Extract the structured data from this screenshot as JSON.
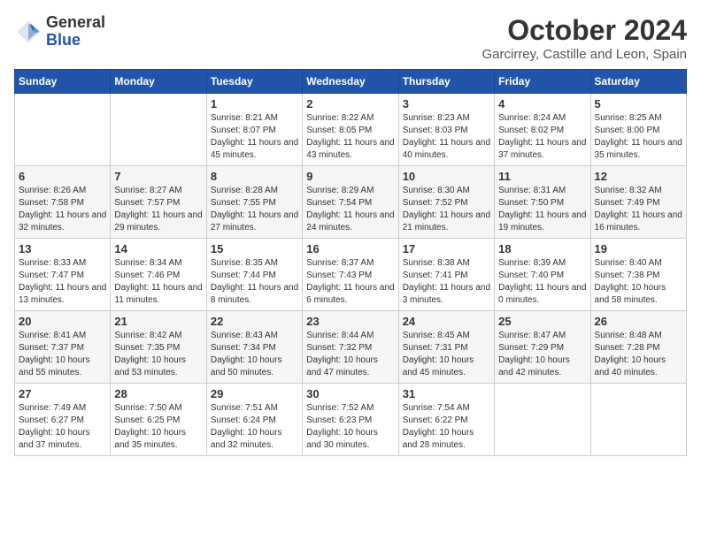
{
  "header": {
    "logo_line1": "General",
    "logo_line2": "Blue",
    "main_title": "October 2024",
    "subtitle": "Garcirrey, Castille and Leon, Spain"
  },
  "calendar": {
    "days_of_week": [
      "Sunday",
      "Monday",
      "Tuesday",
      "Wednesday",
      "Thursday",
      "Friday",
      "Saturday"
    ],
    "weeks": [
      [
        {
          "day": "",
          "info": ""
        },
        {
          "day": "",
          "info": ""
        },
        {
          "day": "1",
          "info": "Sunrise: 8:21 AM\nSunset: 8:07 PM\nDaylight: 11 hours and 45 minutes."
        },
        {
          "day": "2",
          "info": "Sunrise: 8:22 AM\nSunset: 8:05 PM\nDaylight: 11 hours and 43 minutes."
        },
        {
          "day": "3",
          "info": "Sunrise: 8:23 AM\nSunset: 8:03 PM\nDaylight: 11 hours and 40 minutes."
        },
        {
          "day": "4",
          "info": "Sunrise: 8:24 AM\nSunset: 8:02 PM\nDaylight: 11 hours and 37 minutes."
        },
        {
          "day": "5",
          "info": "Sunrise: 8:25 AM\nSunset: 8:00 PM\nDaylight: 11 hours and 35 minutes."
        }
      ],
      [
        {
          "day": "6",
          "info": "Sunrise: 8:26 AM\nSunset: 7:58 PM\nDaylight: 11 hours and 32 minutes."
        },
        {
          "day": "7",
          "info": "Sunrise: 8:27 AM\nSunset: 7:57 PM\nDaylight: 11 hours and 29 minutes."
        },
        {
          "day": "8",
          "info": "Sunrise: 8:28 AM\nSunset: 7:55 PM\nDaylight: 11 hours and 27 minutes."
        },
        {
          "day": "9",
          "info": "Sunrise: 8:29 AM\nSunset: 7:54 PM\nDaylight: 11 hours and 24 minutes."
        },
        {
          "day": "10",
          "info": "Sunrise: 8:30 AM\nSunset: 7:52 PM\nDaylight: 11 hours and 21 minutes."
        },
        {
          "day": "11",
          "info": "Sunrise: 8:31 AM\nSunset: 7:50 PM\nDaylight: 11 hours and 19 minutes."
        },
        {
          "day": "12",
          "info": "Sunrise: 8:32 AM\nSunset: 7:49 PM\nDaylight: 11 hours and 16 minutes."
        }
      ],
      [
        {
          "day": "13",
          "info": "Sunrise: 8:33 AM\nSunset: 7:47 PM\nDaylight: 11 hours and 13 minutes."
        },
        {
          "day": "14",
          "info": "Sunrise: 8:34 AM\nSunset: 7:46 PM\nDaylight: 11 hours and 11 minutes."
        },
        {
          "day": "15",
          "info": "Sunrise: 8:35 AM\nSunset: 7:44 PM\nDaylight: 11 hours and 8 minutes."
        },
        {
          "day": "16",
          "info": "Sunrise: 8:37 AM\nSunset: 7:43 PM\nDaylight: 11 hours and 6 minutes."
        },
        {
          "day": "17",
          "info": "Sunrise: 8:38 AM\nSunset: 7:41 PM\nDaylight: 11 hours and 3 minutes."
        },
        {
          "day": "18",
          "info": "Sunrise: 8:39 AM\nSunset: 7:40 PM\nDaylight: 11 hours and 0 minutes."
        },
        {
          "day": "19",
          "info": "Sunrise: 8:40 AM\nSunset: 7:38 PM\nDaylight: 10 hours and 58 minutes."
        }
      ],
      [
        {
          "day": "20",
          "info": "Sunrise: 8:41 AM\nSunset: 7:37 PM\nDaylight: 10 hours and 55 minutes."
        },
        {
          "day": "21",
          "info": "Sunrise: 8:42 AM\nSunset: 7:35 PM\nDaylight: 10 hours and 53 minutes."
        },
        {
          "day": "22",
          "info": "Sunrise: 8:43 AM\nSunset: 7:34 PM\nDaylight: 10 hours and 50 minutes."
        },
        {
          "day": "23",
          "info": "Sunrise: 8:44 AM\nSunset: 7:32 PM\nDaylight: 10 hours and 47 minutes."
        },
        {
          "day": "24",
          "info": "Sunrise: 8:45 AM\nSunset: 7:31 PM\nDaylight: 10 hours and 45 minutes."
        },
        {
          "day": "25",
          "info": "Sunrise: 8:47 AM\nSunset: 7:29 PM\nDaylight: 10 hours and 42 minutes."
        },
        {
          "day": "26",
          "info": "Sunrise: 8:48 AM\nSunset: 7:28 PM\nDaylight: 10 hours and 40 minutes."
        }
      ],
      [
        {
          "day": "27",
          "info": "Sunrise: 7:49 AM\nSunset: 6:27 PM\nDaylight: 10 hours and 37 minutes."
        },
        {
          "day": "28",
          "info": "Sunrise: 7:50 AM\nSunset: 6:25 PM\nDaylight: 10 hours and 35 minutes."
        },
        {
          "day": "29",
          "info": "Sunrise: 7:51 AM\nSunset: 6:24 PM\nDaylight: 10 hours and 32 minutes."
        },
        {
          "day": "30",
          "info": "Sunrise: 7:52 AM\nSunset: 6:23 PM\nDaylight: 10 hours and 30 minutes."
        },
        {
          "day": "31",
          "info": "Sunrise: 7:54 AM\nSunset: 6:22 PM\nDaylight: 10 hours and 28 minutes."
        },
        {
          "day": "",
          "info": ""
        },
        {
          "day": "",
          "info": ""
        }
      ]
    ]
  }
}
